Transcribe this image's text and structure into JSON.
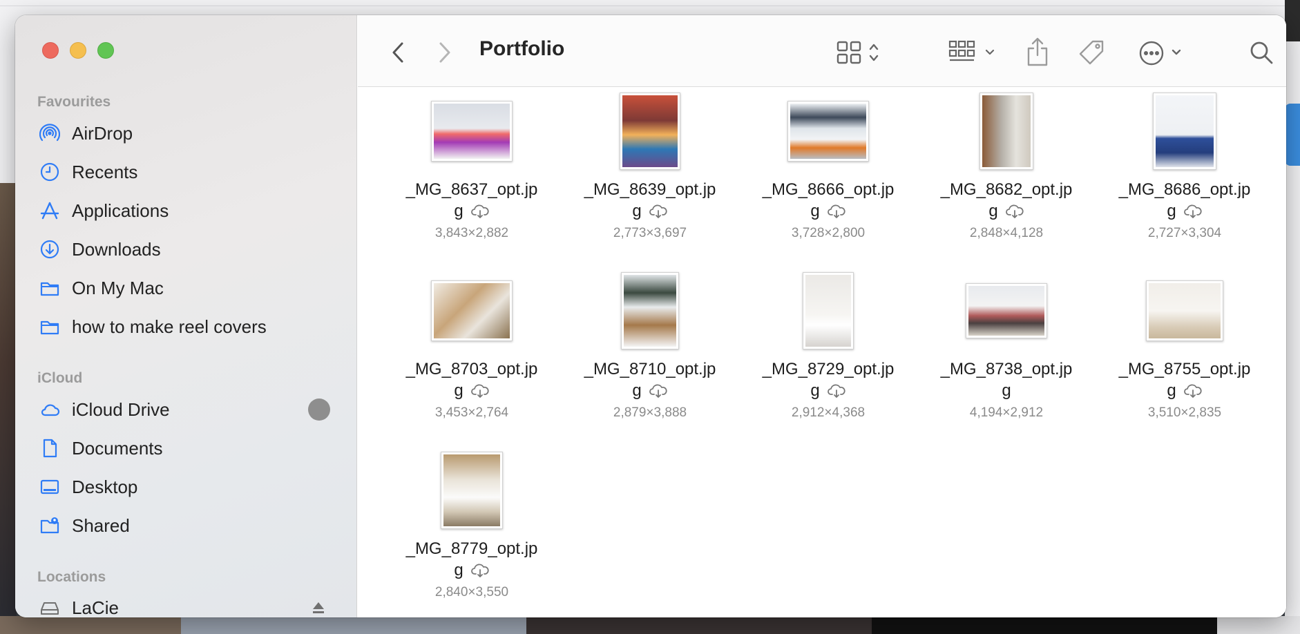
{
  "window": {
    "title": "Portfolio"
  },
  "sidebar": {
    "favourites_title": "Favourites",
    "favourites": [
      {
        "label": "AirDrop",
        "icon": "airdrop-icon"
      },
      {
        "label": "Recents",
        "icon": "clock-icon"
      },
      {
        "label": "Applications",
        "icon": "applications-icon"
      },
      {
        "label": "Downloads",
        "icon": "download-icon"
      },
      {
        "label": "On My Mac",
        "icon": "folder-icon"
      },
      {
        "label": "how to make reel covers",
        "icon": "folder-icon"
      }
    ],
    "icloud_title": "iCloud",
    "icloud": [
      {
        "label": "iCloud Drive",
        "icon": "cloud-icon"
      },
      {
        "label": "Documents",
        "icon": "document-icon"
      },
      {
        "label": "Desktop",
        "icon": "desktop-icon"
      },
      {
        "label": "Shared",
        "icon": "shared-folder-icon"
      }
    ],
    "locations_title": "Locations",
    "locations": [
      {
        "label": "LaCie",
        "icon": "drive-icon"
      }
    ]
  },
  "files": [
    {
      "name1": "_MG_8637_opt.jp",
      "name2": "g",
      "dims": "3,843×2,882",
      "cloud": true
    },
    {
      "name1": "_MG_8639_opt.jp",
      "name2": "g",
      "dims": "2,773×3,697",
      "cloud": true
    },
    {
      "name1": "_MG_8666_opt.jp",
      "name2": "g",
      "dims": "3,728×2,800",
      "cloud": true
    },
    {
      "name1": "_MG_8682_opt.jp",
      "name2": "g",
      "dims": "2,848×4,128",
      "cloud": true
    },
    {
      "name1": "_MG_8686_opt.jp",
      "name2": "g",
      "dims": "2,727×3,304",
      "cloud": true
    },
    {
      "name1": "_MG_8703_opt.jp",
      "name2": "g",
      "dims": "3,453×2,764",
      "cloud": true
    },
    {
      "name1": "_MG_8710_opt.jp",
      "name2": "g",
      "dims": "2,879×3,888",
      "cloud": true
    },
    {
      "name1": "_MG_8729_opt.jp",
      "name2": "g",
      "dims": "2,912×4,368",
      "cloud": true
    },
    {
      "name1": "_MG_8738_opt.jp",
      "name2": "g",
      "dims": "4,194×2,912",
      "cloud": false
    },
    {
      "name1": "_MG_8755_opt.jp",
      "name2": "g",
      "dims": "3,510×2,835",
      "cloud": true
    },
    {
      "name1": "_MG_8779_opt.jp",
      "name2": "g",
      "dims": "2,840×3,550",
      "cloud": true
    }
  ],
  "colors": {
    "accent": "#2f7cf6",
    "close": "#ed6a5e",
    "minimize": "#f5bf4f",
    "maximize": "#61c554"
  }
}
